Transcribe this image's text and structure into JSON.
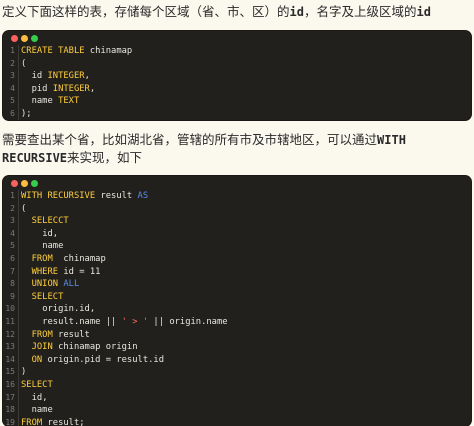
{
  "intro": {
    "text1": "定义下面这样的表，存储每个区域（省、市、区）的",
    "code1": "id",
    "text2": "，名字及上级区域的",
    "code2": "id"
  },
  "block1": {
    "lines": [
      {
        "num": "1",
        "text": "CREATE TABLE chinamap"
      },
      {
        "num": "2",
        "text": "("
      },
      {
        "num": "3",
        "text": "  id INTEGER,"
      },
      {
        "num": "4",
        "text": "  pid INTEGER,"
      },
      {
        "num": "5",
        "text": "  name TEXT"
      },
      {
        "num": "6",
        "text": ");"
      }
    ]
  },
  "para2": {
    "text1": "需要查出某个省，比如湖北省，管辖的所有市及市辖地区，可以通过",
    "code": "WITH RECURSIVE",
    "text2": "来实现，如下"
  },
  "block2": {
    "lines": [
      {
        "num": "1",
        "text": "WITH RECURSIVE result AS"
      },
      {
        "num": "2",
        "text": "("
      },
      {
        "num": "3",
        "text": "  SELECCT"
      },
      {
        "num": "4",
        "text": "    id,"
      },
      {
        "num": "5",
        "text": "    name"
      },
      {
        "num": "6",
        "text": "  FROM  chinamap"
      },
      {
        "num": "7",
        "text": "  WHERE id = 11"
      },
      {
        "num": "8",
        "text": "  UNION ALL"
      },
      {
        "num": "9",
        "text": "  SELECT"
      },
      {
        "num": "10",
        "text": "    origin.id,"
      },
      {
        "num": "11",
        "text": "    result.name || ' > ' || origin.name"
      },
      {
        "num": "12",
        "text": "  FROM result"
      },
      {
        "num": "13",
        "text": "  JOIN chinamap origin"
      },
      {
        "num": "14",
        "text": "  ON origin.pid = result.id"
      },
      {
        "num": "15",
        "text": ")"
      },
      {
        "num": "16",
        "text": "SELECT"
      },
      {
        "num": "17",
        "text": "  id,"
      },
      {
        "num": "18",
        "text": "  name"
      },
      {
        "num": "19",
        "text": "FROM result;"
      }
    ]
  },
  "colors": {
    "page_bg": "#fbf8ee",
    "code_bg": "#21201d",
    "keyword": "#ffce3b",
    "keyword_blue": "#5b8ee6",
    "string": "#ff6e5a",
    "dot_red": "#fc625d",
    "dot_yellow": "#fdbc40",
    "dot_green": "#35cd4b"
  }
}
